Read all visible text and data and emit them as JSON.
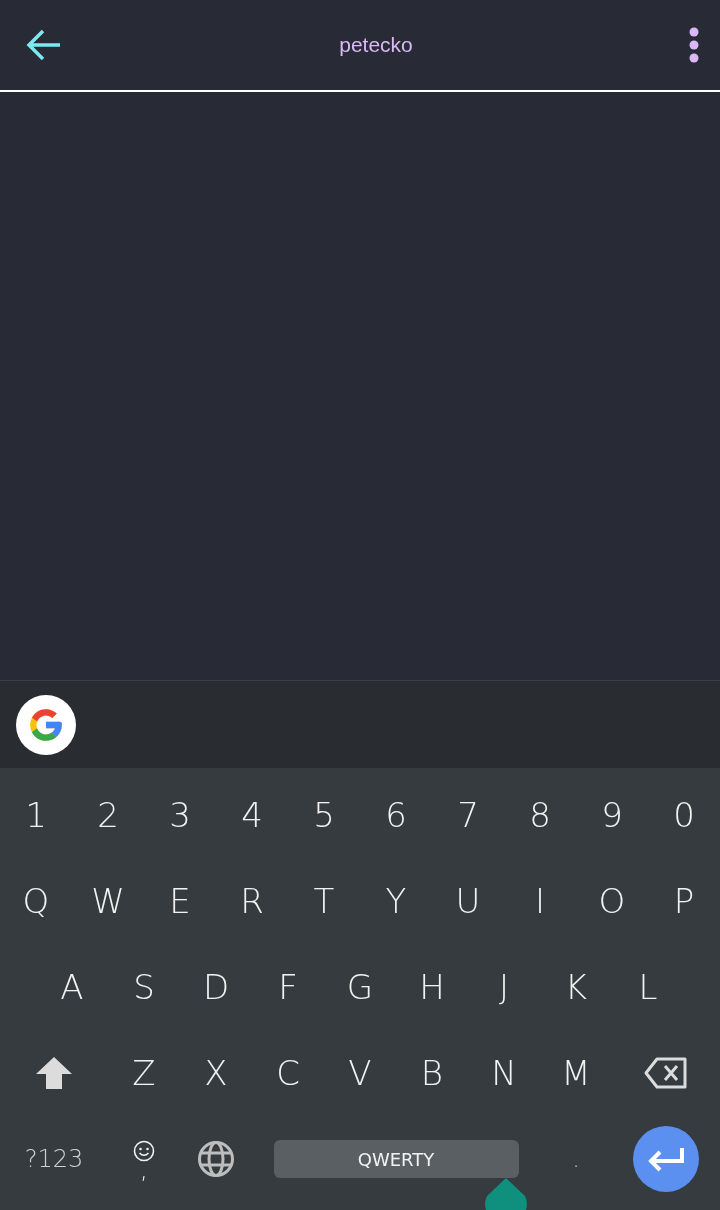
{
  "header": {
    "title": "petecko"
  },
  "keyboard": {
    "key_rows": [
      {
        "keys": [
          {
            "kind": "char",
            "label": "1"
          },
          {
            "kind": "char",
            "label": "2"
          },
          {
            "kind": "char",
            "label": "3"
          },
          {
            "kind": "char",
            "label": "4"
          },
          {
            "kind": "char",
            "label": "5"
          },
          {
            "kind": "char",
            "label": "6"
          },
          {
            "kind": "char",
            "label": "7"
          },
          {
            "kind": "char",
            "label": "8"
          },
          {
            "kind": "char",
            "label": "9"
          },
          {
            "kind": "char",
            "label": "0"
          }
        ]
      },
      {
        "keys": [
          {
            "kind": "char",
            "label": "Q"
          },
          {
            "kind": "char",
            "label": "W"
          },
          {
            "kind": "char",
            "label": "E"
          },
          {
            "kind": "char",
            "label": "R"
          },
          {
            "kind": "char",
            "label": "T"
          },
          {
            "kind": "char",
            "label": "Y"
          },
          {
            "kind": "char",
            "label": "U"
          },
          {
            "kind": "char",
            "label": "I"
          },
          {
            "kind": "char",
            "label": "O"
          },
          {
            "kind": "char",
            "label": "P"
          }
        ]
      },
      {
        "keys": [
          {
            "kind": "char",
            "label": "A"
          },
          {
            "kind": "char",
            "label": "S"
          },
          {
            "kind": "char",
            "label": "D"
          },
          {
            "kind": "char",
            "label": "F"
          },
          {
            "kind": "char",
            "label": "G"
          },
          {
            "kind": "char",
            "label": "H"
          },
          {
            "kind": "char",
            "label": "J"
          },
          {
            "kind": "char",
            "label": "K"
          },
          {
            "kind": "char",
            "label": "L"
          }
        ]
      },
      {
        "keys": [
          {
            "kind": "shift"
          },
          {
            "kind": "char",
            "label": "Z"
          },
          {
            "kind": "char",
            "label": "X"
          },
          {
            "kind": "char",
            "label": "C"
          },
          {
            "kind": "char",
            "label": "V"
          },
          {
            "kind": "char",
            "label": "B"
          },
          {
            "kind": "char",
            "label": "N"
          },
          {
            "kind": "char",
            "label": "M"
          },
          {
            "kind": "backspace"
          }
        ]
      },
      {
        "keys": [
          {
            "kind": "symbols",
            "label": "?123"
          },
          {
            "kind": "emoji",
            "label": ","
          },
          {
            "kind": "globe"
          },
          {
            "kind": "space",
            "label": "QWERTY"
          },
          {
            "kind": "period",
            "label": "."
          },
          {
            "kind": "enter"
          }
        ]
      }
    ]
  }
}
